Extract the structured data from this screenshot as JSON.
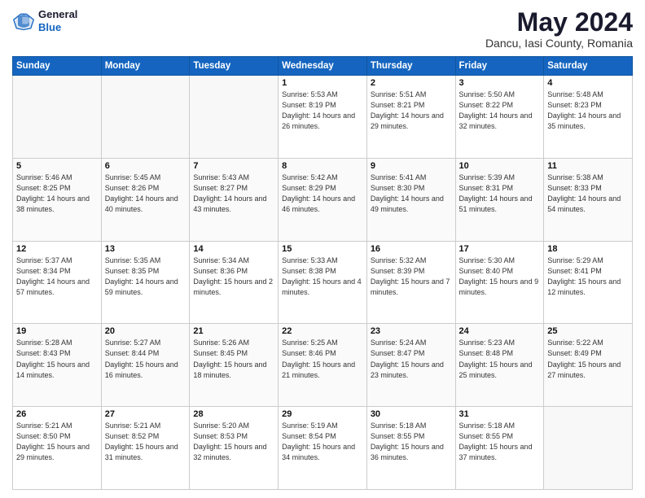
{
  "header": {
    "logo_line1": "General",
    "logo_line2": "Blue",
    "title": "May 2024",
    "subtitle": "Dancu, Iasi County, Romania"
  },
  "weekdays": [
    "Sunday",
    "Monday",
    "Tuesday",
    "Wednesday",
    "Thursday",
    "Friday",
    "Saturday"
  ],
  "weeks": [
    [
      {
        "day": "",
        "sunrise": "",
        "sunset": "",
        "daylight": ""
      },
      {
        "day": "",
        "sunrise": "",
        "sunset": "",
        "daylight": ""
      },
      {
        "day": "",
        "sunrise": "",
        "sunset": "",
        "daylight": ""
      },
      {
        "day": "1",
        "sunrise": "Sunrise: 5:53 AM",
        "sunset": "Sunset: 8:19 PM",
        "daylight": "Daylight: 14 hours and 26 minutes."
      },
      {
        "day": "2",
        "sunrise": "Sunrise: 5:51 AM",
        "sunset": "Sunset: 8:21 PM",
        "daylight": "Daylight: 14 hours and 29 minutes."
      },
      {
        "day": "3",
        "sunrise": "Sunrise: 5:50 AM",
        "sunset": "Sunset: 8:22 PM",
        "daylight": "Daylight: 14 hours and 32 minutes."
      },
      {
        "day": "4",
        "sunrise": "Sunrise: 5:48 AM",
        "sunset": "Sunset: 8:23 PM",
        "daylight": "Daylight: 14 hours and 35 minutes."
      }
    ],
    [
      {
        "day": "5",
        "sunrise": "Sunrise: 5:46 AM",
        "sunset": "Sunset: 8:25 PM",
        "daylight": "Daylight: 14 hours and 38 minutes."
      },
      {
        "day": "6",
        "sunrise": "Sunrise: 5:45 AM",
        "sunset": "Sunset: 8:26 PM",
        "daylight": "Daylight: 14 hours and 40 minutes."
      },
      {
        "day": "7",
        "sunrise": "Sunrise: 5:43 AM",
        "sunset": "Sunset: 8:27 PM",
        "daylight": "Daylight: 14 hours and 43 minutes."
      },
      {
        "day": "8",
        "sunrise": "Sunrise: 5:42 AM",
        "sunset": "Sunset: 8:29 PM",
        "daylight": "Daylight: 14 hours and 46 minutes."
      },
      {
        "day": "9",
        "sunrise": "Sunrise: 5:41 AM",
        "sunset": "Sunset: 8:30 PM",
        "daylight": "Daylight: 14 hours and 49 minutes."
      },
      {
        "day": "10",
        "sunrise": "Sunrise: 5:39 AM",
        "sunset": "Sunset: 8:31 PM",
        "daylight": "Daylight: 14 hours and 51 minutes."
      },
      {
        "day": "11",
        "sunrise": "Sunrise: 5:38 AM",
        "sunset": "Sunset: 8:33 PM",
        "daylight": "Daylight: 14 hours and 54 minutes."
      }
    ],
    [
      {
        "day": "12",
        "sunrise": "Sunrise: 5:37 AM",
        "sunset": "Sunset: 8:34 PM",
        "daylight": "Daylight: 14 hours and 57 minutes."
      },
      {
        "day": "13",
        "sunrise": "Sunrise: 5:35 AM",
        "sunset": "Sunset: 8:35 PM",
        "daylight": "Daylight: 14 hours and 59 minutes."
      },
      {
        "day": "14",
        "sunrise": "Sunrise: 5:34 AM",
        "sunset": "Sunset: 8:36 PM",
        "daylight": "Daylight: 15 hours and 2 minutes."
      },
      {
        "day": "15",
        "sunrise": "Sunrise: 5:33 AM",
        "sunset": "Sunset: 8:38 PM",
        "daylight": "Daylight: 15 hours and 4 minutes."
      },
      {
        "day": "16",
        "sunrise": "Sunrise: 5:32 AM",
        "sunset": "Sunset: 8:39 PM",
        "daylight": "Daylight: 15 hours and 7 minutes."
      },
      {
        "day": "17",
        "sunrise": "Sunrise: 5:30 AM",
        "sunset": "Sunset: 8:40 PM",
        "daylight": "Daylight: 15 hours and 9 minutes."
      },
      {
        "day": "18",
        "sunrise": "Sunrise: 5:29 AM",
        "sunset": "Sunset: 8:41 PM",
        "daylight": "Daylight: 15 hours and 12 minutes."
      }
    ],
    [
      {
        "day": "19",
        "sunrise": "Sunrise: 5:28 AM",
        "sunset": "Sunset: 8:43 PM",
        "daylight": "Daylight: 15 hours and 14 minutes."
      },
      {
        "day": "20",
        "sunrise": "Sunrise: 5:27 AM",
        "sunset": "Sunset: 8:44 PM",
        "daylight": "Daylight: 15 hours and 16 minutes."
      },
      {
        "day": "21",
        "sunrise": "Sunrise: 5:26 AM",
        "sunset": "Sunset: 8:45 PM",
        "daylight": "Daylight: 15 hours and 18 minutes."
      },
      {
        "day": "22",
        "sunrise": "Sunrise: 5:25 AM",
        "sunset": "Sunset: 8:46 PM",
        "daylight": "Daylight: 15 hours and 21 minutes."
      },
      {
        "day": "23",
        "sunrise": "Sunrise: 5:24 AM",
        "sunset": "Sunset: 8:47 PM",
        "daylight": "Daylight: 15 hours and 23 minutes."
      },
      {
        "day": "24",
        "sunrise": "Sunrise: 5:23 AM",
        "sunset": "Sunset: 8:48 PM",
        "daylight": "Daylight: 15 hours and 25 minutes."
      },
      {
        "day": "25",
        "sunrise": "Sunrise: 5:22 AM",
        "sunset": "Sunset: 8:49 PM",
        "daylight": "Daylight: 15 hours and 27 minutes."
      }
    ],
    [
      {
        "day": "26",
        "sunrise": "Sunrise: 5:21 AM",
        "sunset": "Sunset: 8:50 PM",
        "daylight": "Daylight: 15 hours and 29 minutes."
      },
      {
        "day": "27",
        "sunrise": "Sunrise: 5:21 AM",
        "sunset": "Sunset: 8:52 PM",
        "daylight": "Daylight: 15 hours and 31 minutes."
      },
      {
        "day": "28",
        "sunrise": "Sunrise: 5:20 AM",
        "sunset": "Sunset: 8:53 PM",
        "daylight": "Daylight: 15 hours and 32 minutes."
      },
      {
        "day": "29",
        "sunrise": "Sunrise: 5:19 AM",
        "sunset": "Sunset: 8:54 PM",
        "daylight": "Daylight: 15 hours and 34 minutes."
      },
      {
        "day": "30",
        "sunrise": "Sunrise: 5:18 AM",
        "sunset": "Sunset: 8:55 PM",
        "daylight": "Daylight: 15 hours and 36 minutes."
      },
      {
        "day": "31",
        "sunrise": "Sunrise: 5:18 AM",
        "sunset": "Sunset: 8:55 PM",
        "daylight": "Daylight: 15 hours and 37 minutes."
      },
      {
        "day": "",
        "sunrise": "",
        "sunset": "",
        "daylight": ""
      }
    ]
  ]
}
